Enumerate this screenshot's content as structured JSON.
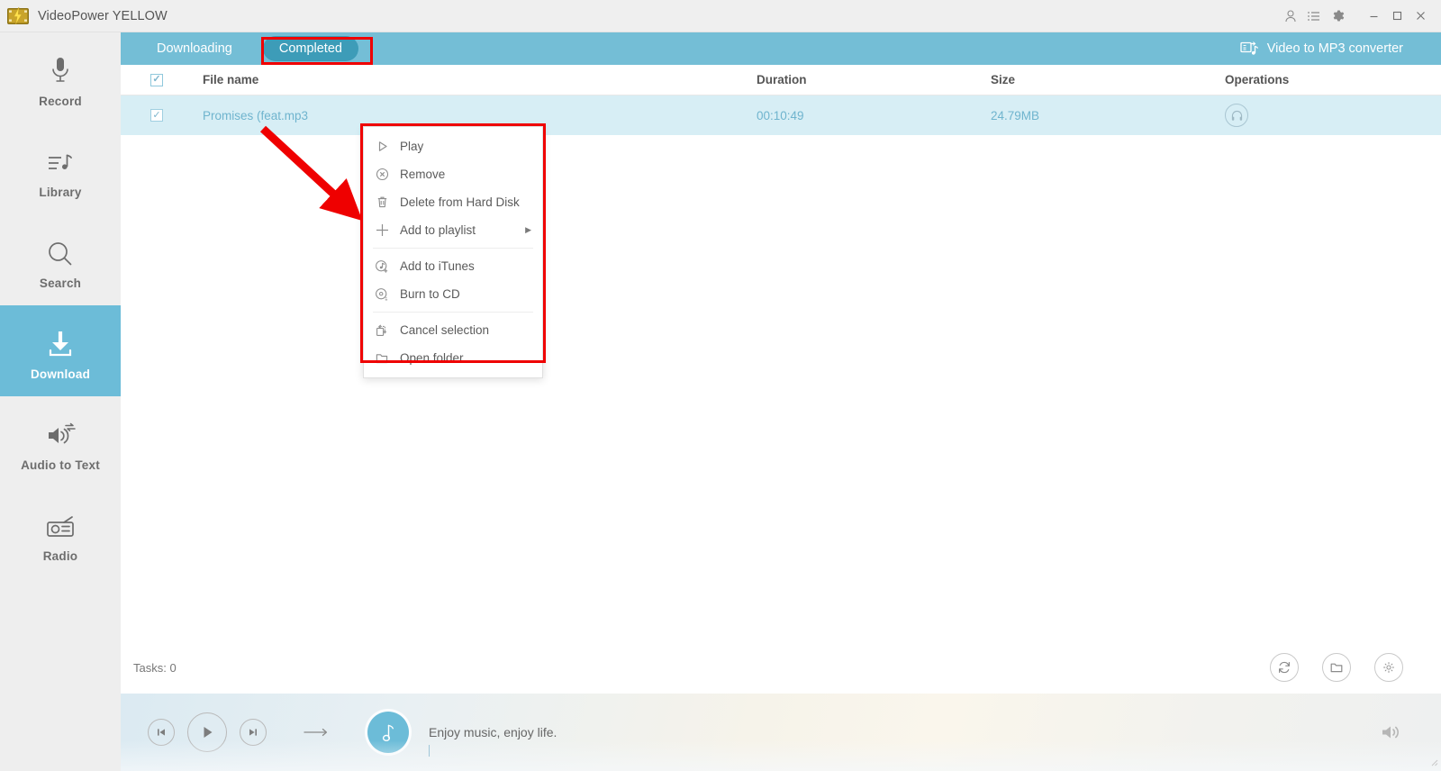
{
  "window": {
    "title": "VideoPower YELLOW",
    "logo_icon": "film-reel-bolt-icon",
    "controls": {
      "account_icon": "person-icon",
      "list_icon": "list-icon",
      "settings_icon": "gear-icon",
      "minimize": "–",
      "maximize": "▢",
      "close": "✕"
    }
  },
  "sidebar": {
    "items": [
      {
        "label": "Record",
        "icon": "microphone-icon",
        "active": false
      },
      {
        "label": "Library",
        "icon": "music-library-icon",
        "active": false
      },
      {
        "label": "Search",
        "icon": "search-icon",
        "active": false
      },
      {
        "label": "Download",
        "icon": "download-icon",
        "active": true
      },
      {
        "label": "Audio to Text",
        "icon": "audio-to-text-icon",
        "active": false
      },
      {
        "label": "Radio",
        "icon": "radio-icon",
        "active": false
      }
    ]
  },
  "tabs": {
    "downloading": "Downloading",
    "completed": "Completed",
    "active": "Completed",
    "converter_label": "Video to MP3 converter",
    "converter_icon": "video-to-mp3-icon"
  },
  "table": {
    "columns": {
      "file_name": "File name",
      "duration": "Duration",
      "size": "Size",
      "operations": "Operations"
    },
    "header_checkbox_checked": true,
    "rows": [
      {
        "checked": true,
        "file_name": "Promises (feat.mp3",
        "duration": "00:10:49",
        "size": "24.79MB",
        "operation_icon": "headphones-icon"
      }
    ]
  },
  "context_menu": {
    "items": [
      {
        "label": "Play",
        "icon": "play-triangle-icon",
        "submenu": false,
        "separator_after": false
      },
      {
        "label": "Remove",
        "icon": "remove-circle-x-icon",
        "submenu": false,
        "separator_after": false
      },
      {
        "label": "Delete from Hard Disk",
        "icon": "trash-icon",
        "submenu": false,
        "separator_after": false
      },
      {
        "label": "Add to playlist",
        "icon": "plus-icon",
        "submenu": true,
        "separator_after": true
      },
      {
        "label": "Add to iTunes",
        "icon": "add-to-itunes-icon",
        "submenu": false,
        "separator_after": false
      },
      {
        "label": "Burn to CD",
        "icon": "burn-to-cd-icon",
        "submenu": false,
        "separator_after": true
      },
      {
        "label": "Cancel selection",
        "icon": "cancel-selection-icon",
        "submenu": false,
        "separator_after": false
      },
      {
        "label": "Open folder",
        "icon": "folder-icon",
        "submenu": false,
        "separator_after": false
      }
    ],
    "submenu_arrow": "▶"
  },
  "status_bar": {
    "tasks_label": "Tasks: 0",
    "actions": [
      {
        "name": "refresh",
        "icon": "refresh-icon"
      },
      {
        "name": "open-folder",
        "icon": "folder-icon"
      },
      {
        "name": "settings",
        "icon": "gear-icon"
      }
    ]
  },
  "player": {
    "prev_icon": "previous-track-icon",
    "play_icon": "play-icon",
    "next_icon": "next-track-icon",
    "repeat_icon": "repeat-arrow-icon",
    "album_icon": "music-note-icon",
    "message": "Enjoy music, enjoy life.",
    "volume_icon": "volume-icon"
  },
  "annotations": {
    "tab_highlight": "Completed",
    "menu_highlight": "context-menu",
    "arrow_color": "#ef0000"
  },
  "colors": {
    "accent_teal": "#6cbcd8",
    "tabbar_teal": "#74bed6",
    "active_tab": "#3d9cb8",
    "row_selected": "#d7eef5",
    "annotation_red": "#ef0000"
  }
}
